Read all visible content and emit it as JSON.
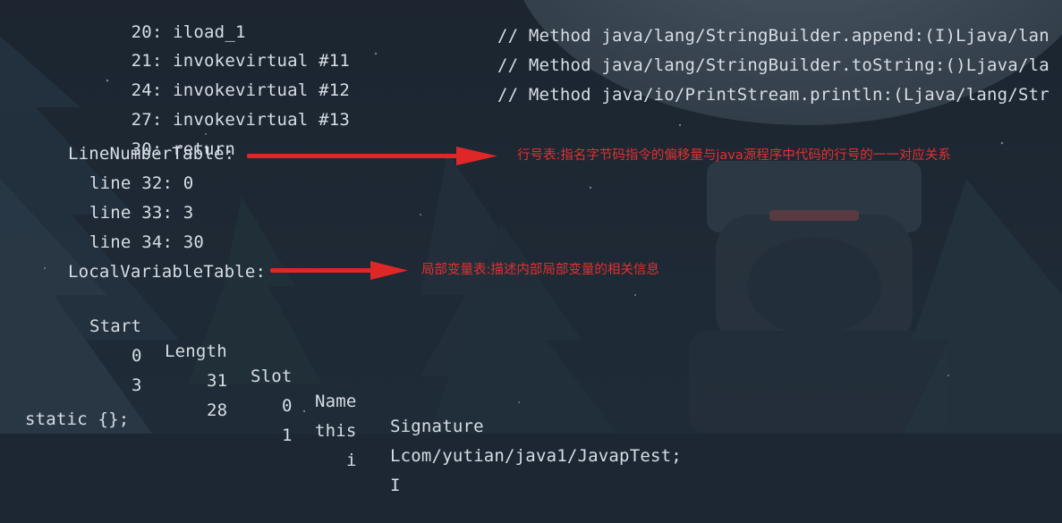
{
  "colors": {
    "code_text": "#d7dde4",
    "annotation": "#e23030",
    "background": "#1d2733"
  },
  "bytecode": [
    {
      "text": "20: iload_1",
      "comment": ""
    },
    {
      "text": "21: invokevirtual #11",
      "comment": "// Method java/lang/StringBuilder.append:(I)Ljava/lan"
    },
    {
      "text": "24: invokevirtual #12",
      "comment": "// Method java/lang/StringBuilder.toString:()Ljava/la"
    },
    {
      "text": "27: invokevirtual #13",
      "comment": "// Method java/io/PrintStream.println:(Ljava/lang/Str"
    },
    {
      "text": "30: return",
      "comment": ""
    }
  ],
  "line_number_table": {
    "header": "LineNumberTable:",
    "annotation": "行号表:指名字节码指令的偏移量与java源程序中代码的行号的一一对应关系",
    "rows": [
      "line 32: 0",
      "line 33: 3",
      "line 34: 30"
    ]
  },
  "local_variable_table": {
    "header": "LocalVariableTable:",
    "annotation": "局部变量表:描述内部局部变量的相关信息",
    "columns": [
      "Start",
      "Length",
      "Slot",
      "Name",
      "Signature"
    ],
    "rows": [
      [
        "0",
        "31",
        "0",
        "this",
        "Lcom/yutian/java1/JavapTest;"
      ],
      [
        "3",
        "28",
        "1",
        "i",
        "I"
      ]
    ]
  },
  "footer": "static {};"
}
